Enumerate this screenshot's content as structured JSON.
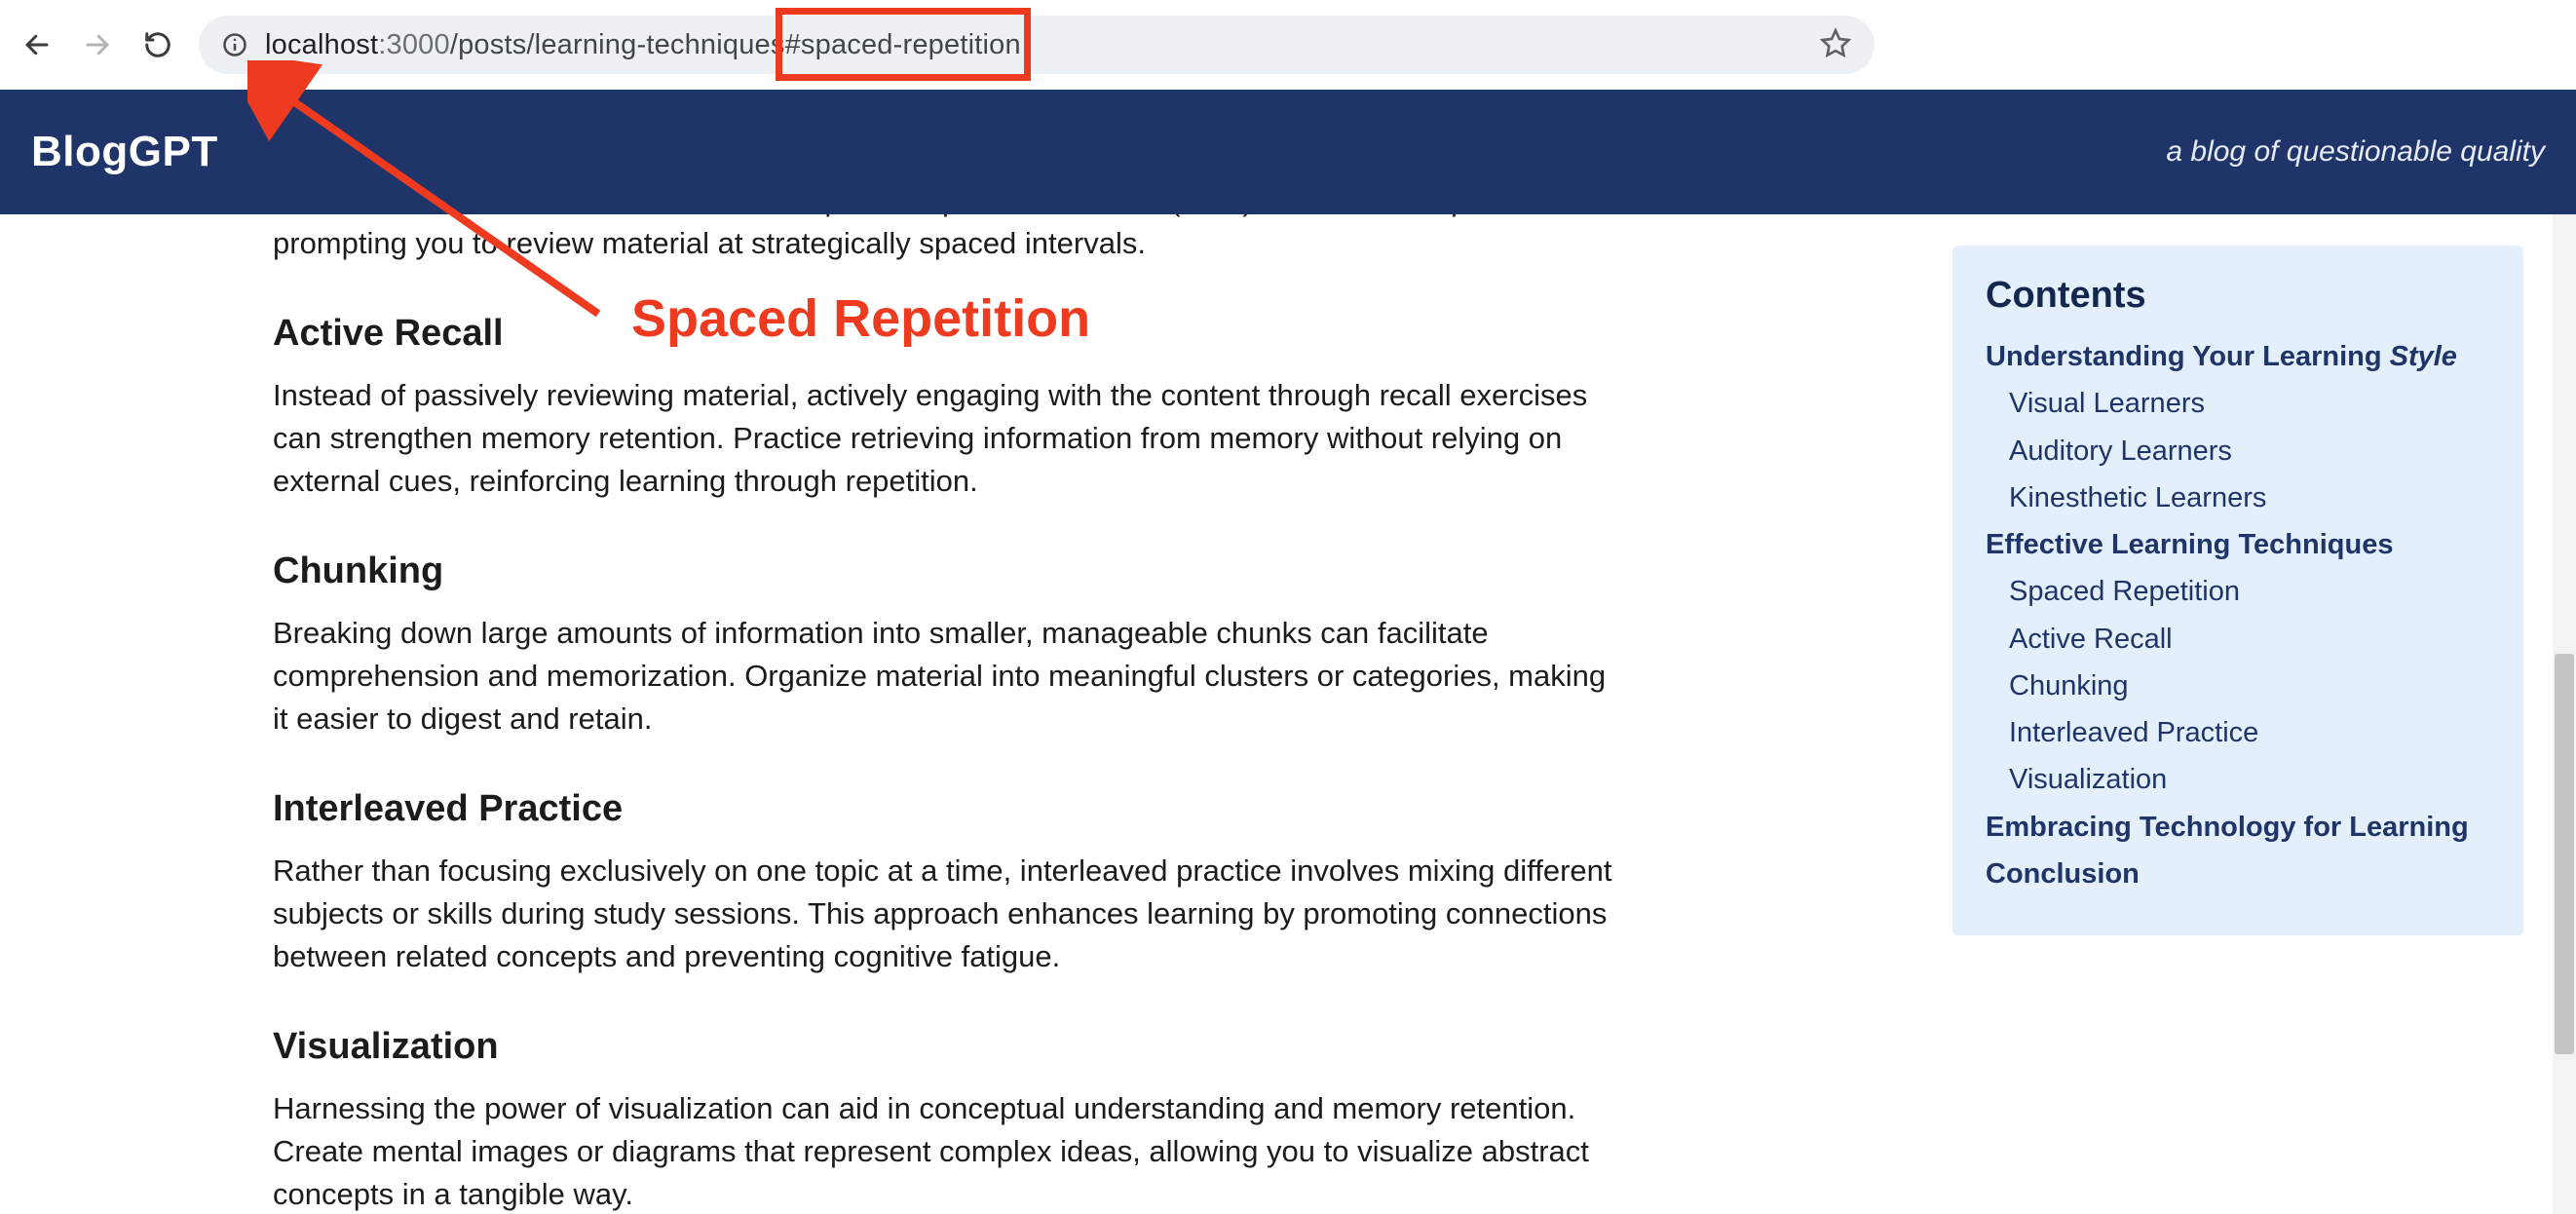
{
  "browser": {
    "url_host_strong": "localhost",
    "url_host_weak": ":3000",
    "url_path": "/posts/learning-techniques",
    "url_hash": "#spaced-repetition"
  },
  "header": {
    "brand": "BlogGPT",
    "tagline": "a blog of questionable quality"
  },
  "annotation": {
    "label": "Spaced Repetition"
  },
  "article": {
    "lead_fragment": "of information. Tools like flashcards and spaced repetition software (SRS) automate this process, prompting you to review material at strategically spaced intervals.",
    "sections": [
      {
        "heading": "Active Recall",
        "body": "Instead of passively reviewing material, actively engaging with the content through recall exercises can strengthen memory retention. Practice retrieving information from memory without relying on external cues, reinforcing learning through repetition."
      },
      {
        "heading": "Chunking",
        "body": "Breaking down large amounts of information into smaller, manageable chunks can facilitate comprehension and memorization. Organize material into meaningful clusters or categories, making it easier to digest and retain."
      },
      {
        "heading": "Interleaved Practice",
        "body": "Rather than focusing exclusively on one topic at a time, interleaved practice involves mixing different subjects or skills during study sessions. This approach enhances learning by promoting connections between related concepts and preventing cognitive fatigue."
      },
      {
        "heading": "Visualization",
        "body": "Harnessing the power of visualization can aid in conceptual understanding and memory retention. Create mental images or diagrams that represent complex ideas, allowing you to visualize abstract concepts in a tangible way."
      }
    ]
  },
  "toc": {
    "title": "Contents",
    "items": [
      {
        "level": 1,
        "label_pre": "Understanding Your Learning ",
        "label_ital": "Style"
      },
      {
        "level": 2,
        "label_pre": "Visual Learners"
      },
      {
        "level": 2,
        "label_pre": "Auditory Learners"
      },
      {
        "level": 2,
        "label_pre": "Kinesthetic Learners"
      },
      {
        "level": 1,
        "label_pre": "Effective Learning Techniques"
      },
      {
        "level": 2,
        "label_pre": "Spaced Repetition"
      },
      {
        "level": 2,
        "label_pre": "Active Recall"
      },
      {
        "level": 2,
        "label_pre": "Chunking"
      },
      {
        "level": 2,
        "label_pre": "Interleaved Practice"
      },
      {
        "level": 2,
        "label_pre": "Visualization"
      },
      {
        "level": 1,
        "label_pre": "Embracing Technology for Learning"
      },
      {
        "level": 1,
        "label_pre": "Conclusion"
      }
    ]
  }
}
